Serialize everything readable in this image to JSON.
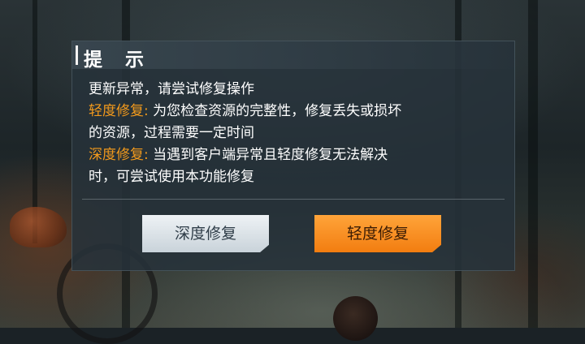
{
  "dialog": {
    "title": "提 示",
    "line1": "更新异常，请尝试修复操作",
    "light_label": "轻度修复:",
    "light_desc_a": " 为您检查资源的完整性，修复丢失或损坏",
    "light_desc_b": "的资源，过程需要一定时间",
    "deep_label": "深度修复:",
    "deep_desc_a": " 当遇到客户端异常且轻度修复无法解决",
    "deep_desc_b": "时，可尝试使用本功能修复"
  },
  "buttons": {
    "deep": "深度修复",
    "light": "轻度修复"
  },
  "colors": {
    "accent": "#f39a1c",
    "primary_button": "#f58a1f",
    "secondary_button": "#dfe6eb"
  }
}
